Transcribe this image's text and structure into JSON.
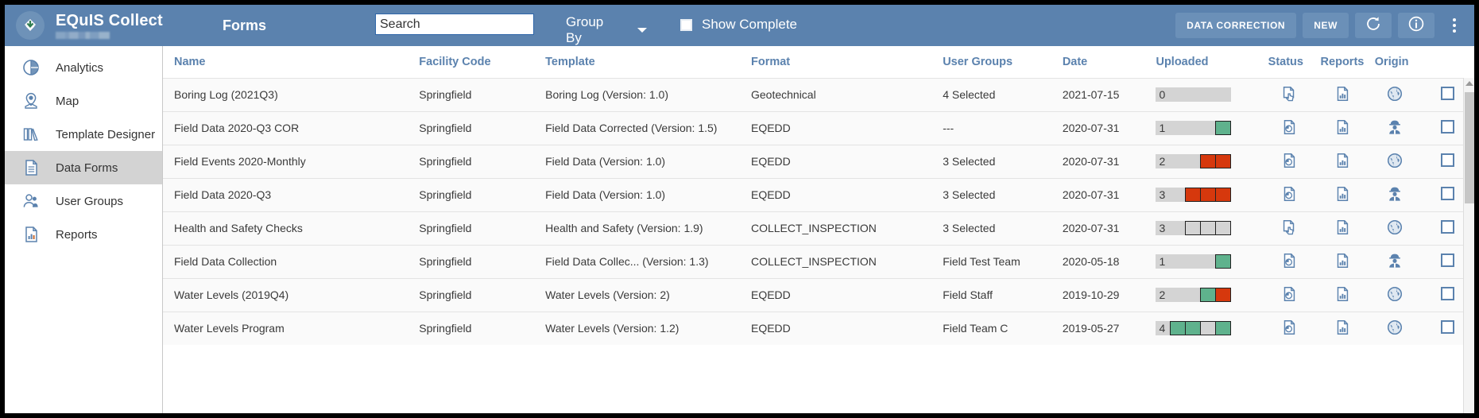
{
  "topbar": {
    "logo_icon": "equis-drop-logo-icon",
    "brand_title": "EQuIS Collect",
    "brand_subtitle_redacted": "",
    "nav_label": "Forms",
    "search_placeholder": "Search",
    "search_value": "",
    "group_by_label": "Group By",
    "show_complete_label": "Show Complete",
    "show_complete_checked": false,
    "data_correction_label": "DATA CORRECTION",
    "new_label": "NEW",
    "refresh_icon": "refresh-icon",
    "info_icon": "info-icon",
    "more_icon": "kebab-menu-icon",
    "bar_color": "#5b82ae",
    "button_color": "#6b90b8"
  },
  "sidebar": {
    "items": [
      {
        "label": "Analytics",
        "icon": "pie-chart-icon",
        "active": false
      },
      {
        "label": "Map",
        "icon": "map-pin-icon",
        "active": false
      },
      {
        "label": "Template Designer",
        "icon": "books-icon",
        "active": false
      },
      {
        "label": "Data Forms",
        "icon": "document-icon",
        "active": true
      },
      {
        "label": "User Groups",
        "icon": "users-icon",
        "active": false
      },
      {
        "label": "Reports",
        "icon": "report-chart-icon",
        "active": false
      }
    ],
    "active_background": "#d3d3d3",
    "icon_color": "#5b82ae"
  },
  "table": {
    "columns": [
      "Name",
      "Facility Code",
      "Template",
      "Format",
      "User Groups",
      "Date",
      "Uploaded",
      "Status",
      "Reports",
      "Origin"
    ],
    "rows": [
      {
        "name": "Boring Log (2021Q3)",
        "facility_code": "Springfield",
        "template": "Boring Log (Version: 1.0)",
        "format": "Geotechnical",
        "user_groups": "4 Selected",
        "date": "2021-07-15",
        "uploaded_count": "0",
        "uploaded_cells": [],
        "status_icon": "document-tap-icon",
        "reports_icon": "document-chart-icon",
        "origin_icon": "globe-icon",
        "selected": false
      },
      {
        "name": "Field Data 2020-Q3 COR",
        "facility_code": "Springfield",
        "template": "Field Data Corrected (Version: 1.5)",
        "format": "EQEDD",
        "user_groups": "---",
        "date": "2020-07-31",
        "uploaded_count": "1",
        "uploaded_cells": [
          "green"
        ],
        "status_icon": "document-pie-icon",
        "reports_icon": "document-chart-icon",
        "origin_icon": "field-worker-icon",
        "selected": false
      },
      {
        "name": "Field Events 2020-Monthly",
        "facility_code": "Springfield",
        "template": "Field Data (Version: 1.0)",
        "format": "EQEDD",
        "user_groups": "3 Selected",
        "date": "2020-07-31",
        "uploaded_count": "2",
        "uploaded_cells": [
          "red",
          "red"
        ],
        "status_icon": "document-pie-icon",
        "reports_icon": "document-chart-icon",
        "origin_icon": "globe-icon",
        "selected": false
      },
      {
        "name": "Field Data 2020-Q3",
        "facility_code": "Springfield",
        "template": "Field Data (Version: 1.0)",
        "format": "EQEDD",
        "user_groups": "3 Selected",
        "date": "2020-07-31",
        "uploaded_count": "3",
        "uploaded_cells": [
          "red",
          "red",
          "red"
        ],
        "status_icon": "document-pie-icon",
        "reports_icon": "document-chart-icon",
        "origin_icon": "field-worker-icon",
        "selected": false
      },
      {
        "name": "Health and Safety Checks",
        "facility_code": "Springfield",
        "template": "Health and Safety (Version: 1.9)",
        "format": "COLLECT_INSPECTION",
        "user_groups": "3 Selected",
        "date": "2020-07-31",
        "uploaded_count": "3",
        "uploaded_cells": [
          "empty",
          "empty",
          "empty"
        ],
        "status_icon": "document-tap-icon",
        "reports_icon": "document-chart-icon",
        "origin_icon": "globe-icon",
        "selected": false
      },
      {
        "name": "Field Data Collection",
        "facility_code": "Springfield",
        "template": "Field Data Collec... (Version: 1.3)",
        "format": "COLLECT_INSPECTION",
        "user_groups": "Field Test Team",
        "date": "2020-05-18",
        "uploaded_count": "1",
        "uploaded_cells": [
          "green"
        ],
        "status_icon": "document-pie-icon",
        "reports_icon": "document-chart-icon",
        "origin_icon": "field-worker-icon",
        "selected": false
      },
      {
        "name": "Water Levels (2019Q4)",
        "facility_code": "Springfield",
        "template": "Water Levels (Version: 2)",
        "format": "EQEDD",
        "user_groups": "Field Staff",
        "date": "2019-10-29",
        "uploaded_count": "2",
        "uploaded_cells": [
          "green",
          "red"
        ],
        "status_icon": "document-pie-icon",
        "reports_icon": "document-chart-icon",
        "origin_icon": "globe-icon",
        "selected": false
      },
      {
        "name": "Water Levels Program",
        "facility_code": "Springfield",
        "template": "Water Levels (Version: 1.2)",
        "format": "EQEDD",
        "user_groups": "Field Team C",
        "date": "2019-05-27",
        "uploaded_count": "4",
        "uploaded_cells": [
          "green",
          "green",
          "empty",
          "green"
        ],
        "status_icon": "document-pie-icon",
        "reports_icon": "document-chart-icon",
        "origin_icon": "globe-icon",
        "selected": false
      }
    ],
    "header_color": "#5b82ae",
    "progress_green": "#5fb28d",
    "progress_red": "#d6380d",
    "progress_track": "#d4d4d4"
  }
}
